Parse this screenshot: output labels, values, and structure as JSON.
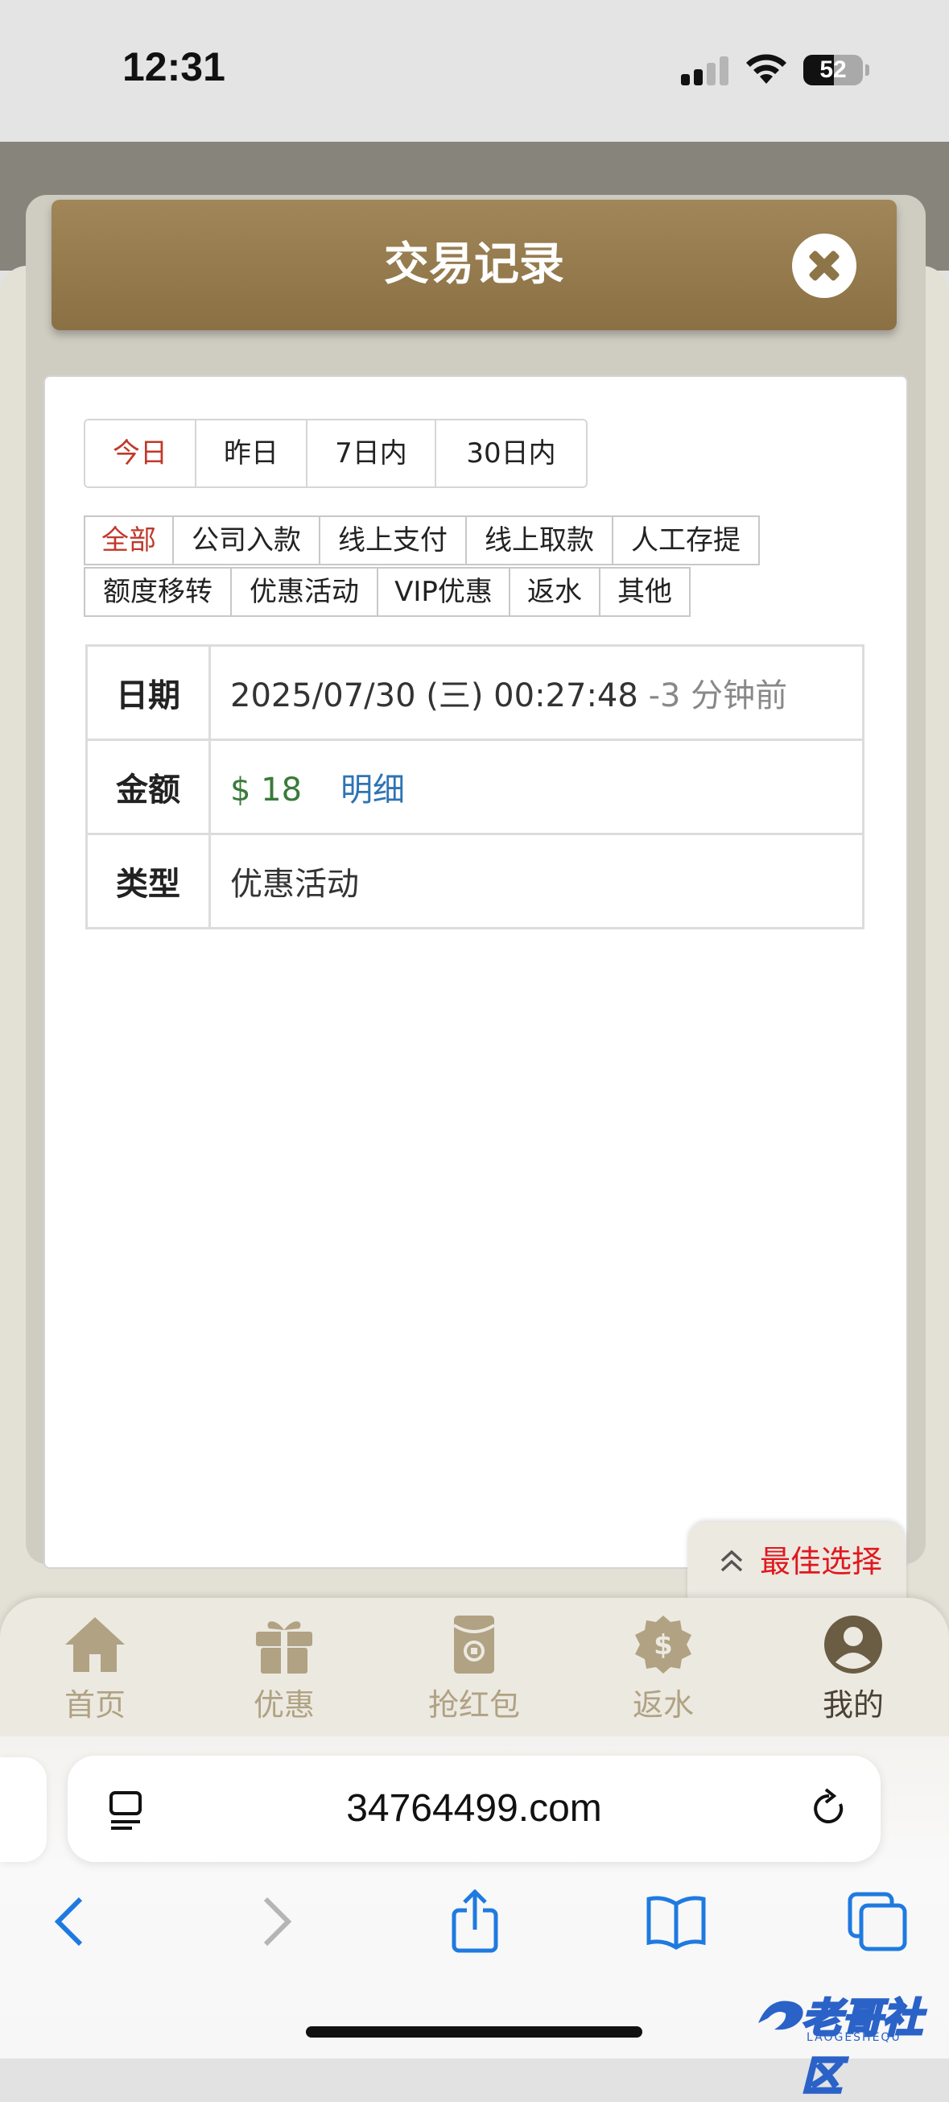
{
  "status_bar": {
    "time": "12:31",
    "battery": "52"
  },
  "modal": {
    "title": "交易记录"
  },
  "date_tabs": [
    "今日",
    "昨日",
    "7日内",
    "30日内"
  ],
  "category_rows": [
    [
      "全部",
      "公司入款",
      "线上支付",
      "线上取款",
      "人工存提"
    ],
    [
      "额度移转",
      "优惠活动",
      "VIP优惠",
      "返水",
      "其他"
    ]
  ],
  "record": {
    "date_label": "日期",
    "date_value": "2025/07/30 (三) 00:27:48",
    "date_ago": "-3 分钟前",
    "amount_label": "金额",
    "amount_value": "$ 18",
    "detail_link": "明细",
    "type_label": "类型",
    "type_value": "优惠活动"
  },
  "best_choice": "最佳选择",
  "bottom_nav": [
    {
      "label": "首页",
      "icon": "home-icon"
    },
    {
      "label": "优惠",
      "icon": "gift-icon"
    },
    {
      "label": "抢红包",
      "icon": "red-envelope-icon"
    },
    {
      "label": "返水",
      "icon": "dollar-badge-icon"
    },
    {
      "label": "我的",
      "icon": "user-icon"
    }
  ],
  "browser": {
    "url": "34764499.com"
  },
  "watermark": {
    "text": "老哥社区",
    "sub": "LAOGESHEQU"
  },
  "colors": {
    "accent_red": "#c0392b",
    "header_brown": "#94794a",
    "amount_green": "#3a7a3a",
    "link_blue": "#2e74b5",
    "best_choice_red": "#e0181e"
  }
}
